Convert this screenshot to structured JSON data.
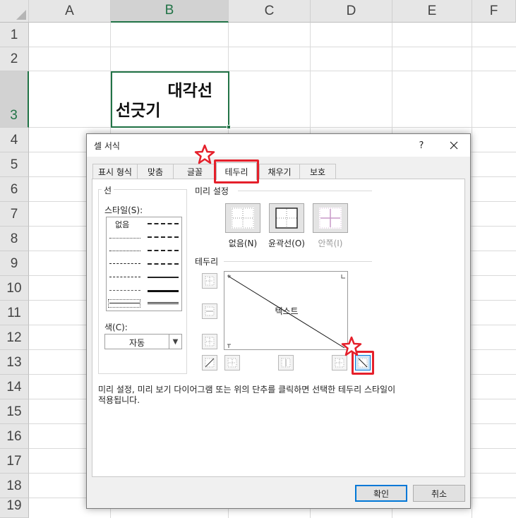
{
  "sheet": {
    "columns": [
      "A",
      "B",
      "C",
      "D",
      "E",
      "F"
    ],
    "active_column": "B",
    "rows": [
      "1",
      "2",
      "3",
      "4",
      "5",
      "6",
      "7",
      "8",
      "9",
      "10",
      "11",
      "12",
      "13",
      "14",
      "15",
      "16",
      "17",
      "18",
      "19"
    ],
    "active_row": "3",
    "cell_b3": {
      "line1": "대각선",
      "line2": "선긋기"
    }
  },
  "dialog": {
    "title": "셀 서식",
    "help_label": "?",
    "tabs": [
      {
        "label": "표시 형식"
      },
      {
        "label": "맞춤"
      },
      {
        "label": "글꼴"
      },
      {
        "label": "테두리"
      },
      {
        "label": "채우기"
      },
      {
        "label": "보호"
      }
    ],
    "active_tab": "테두리",
    "line_group": {
      "legend": "선",
      "style_label": "스타일(S):",
      "style_none": "없음",
      "color_label": "색(C):",
      "color_value": "자동"
    },
    "presets": {
      "legend": "미리 설정",
      "items": [
        {
          "label": "없음(N)",
          "enabled": true
        },
        {
          "label": "윤곽선(O)",
          "enabled": true
        },
        {
          "label": "안쪽(I)",
          "enabled": false
        }
      ]
    },
    "border": {
      "legend": "테두리",
      "preview_text": "텍스트",
      "diagonal": "top-left-to-bottom-right"
    },
    "description": [
      "미리 설정, 미리 보기 다이어그램 또는 위의 단추를 클릭하면 선택한 테두리 스타일이",
      "적용됩니다."
    ],
    "ok_label": "확인",
    "cancel_label": "취소"
  },
  "colors": {
    "excel_green": "#217346",
    "highlight_red": "#e5202b",
    "focus_blue": "#0078d7"
  }
}
